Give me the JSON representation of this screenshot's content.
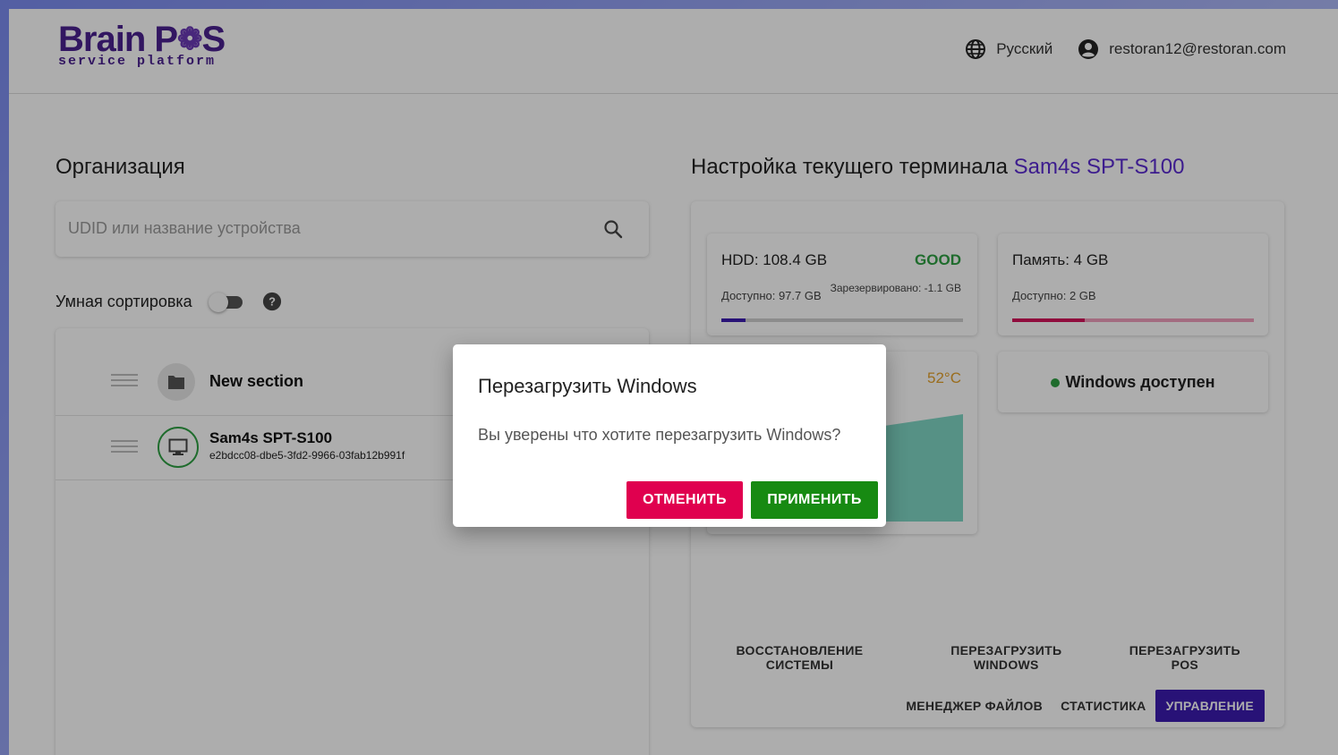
{
  "header": {
    "logo_main": "Brain P",
    "logo_main_end": "S",
    "logo_sub": "service platform",
    "language": "Русский",
    "user_email": "restoran12@restoran.com"
  },
  "left": {
    "title": "Организация",
    "search_placeholder": "UDID или название устройства",
    "smart_sort_label": "Умная сортировка",
    "smart_sort_on": false,
    "section_name": "New section",
    "device_name": "Sam4s SPT-S100",
    "device_uuid": "e2bdcc08-dbe5-3fd2-9966-03fab12b991f"
  },
  "right": {
    "title_prefix": "Настройка текущего терминала",
    "terminal_name": "Sam4s SPT-S100",
    "hdd": {
      "title": "HDD: 108.4 GB",
      "status": "GOOD",
      "available": "Доступно: 97.7 GB",
      "reserved": "Зарезервировано: -1.1 GB",
      "used_fraction": 0.1
    },
    "memory": {
      "title": "Память: 4 GB",
      "available": "Доступно: 2 GB",
      "used_fraction": 0.3
    },
    "cpu": {
      "temperature": "52°C"
    },
    "windows_status": "Windows доступен",
    "actions_row1": [
      "ВОССТАНОВЛЕНИЕ СИСТЕМЫ",
      "ПЕРЕЗАГРУЗИТЬ WINDOWS",
      "ПЕРЕЗАГРУЗИТЬ POS"
    ],
    "actions_row2": [
      "МЕНЕДЖЕР ФАЙЛОВ",
      "СТАТИСТИКА",
      "УПРАВЛЕНИЕ"
    ]
  },
  "dialog": {
    "title": "Перезагрузить Windows",
    "text": "Вы уверены что хотите перезагрузить Windows?",
    "cancel": "ОТМЕНИТЬ",
    "apply": "ПРИМЕНИТЬ"
  },
  "colors": {
    "brand": "#4b2190",
    "accent": "#3b1bb0",
    "good": "#2ea043",
    "cancel": "#e0004f",
    "apply": "#178a12",
    "temp": "#e3a12c"
  }
}
